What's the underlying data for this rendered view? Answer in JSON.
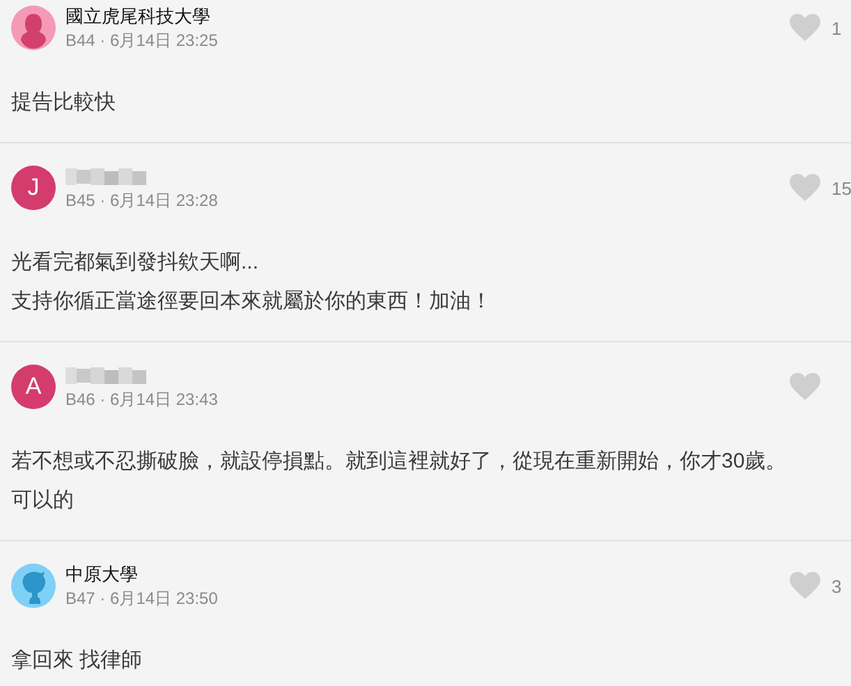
{
  "comments": [
    {
      "avatar": {
        "kind": "female"
      },
      "author": "國立虎尾科技大學",
      "meta": "B44 · 6月14日 23:25",
      "likes": "1",
      "body": [
        "提告比較快"
      ]
    },
    {
      "avatar": {
        "kind": "letter",
        "letter": "J"
      },
      "author_redacted": true,
      "meta": "B45 · 6月14日 23:28",
      "likes": "15",
      "body": [
        "光看完都氣到發抖欸天啊...",
        "支持你循正當途徑要回本來就屬於你的東西！加油！"
      ]
    },
    {
      "avatar": {
        "kind": "letter",
        "letter": "A"
      },
      "author_redacted": true,
      "meta": "B46 · 6月14日 23:43",
      "body": [
        "若不想或不忍撕破臉，就設停損點。就到這裡就好了，從現在重新開始，你才30歲。",
        "可以的"
      ]
    },
    {
      "avatar": {
        "kind": "male"
      },
      "author": "中原大學",
      "meta": "B47 · 6月14日 23:50",
      "likes": "3",
      "body": [
        "拿回來 找律師"
      ]
    }
  ]
}
